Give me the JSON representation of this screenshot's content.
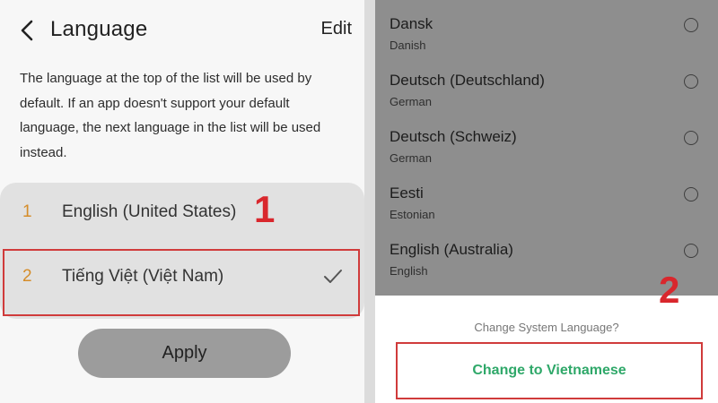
{
  "left": {
    "header": {
      "title": "Language",
      "edit_label": "Edit"
    },
    "description": "The language at the top of the list will be used by default. If an app doesn't support your default language, the next language in the list will be used instead.",
    "languages": [
      {
        "num": "1",
        "name": "English (United States)"
      },
      {
        "num": "2",
        "name": "Tiếng Việt (Việt Nam)",
        "selected": true
      }
    ],
    "step_label": "1",
    "apply_label": "Apply"
  },
  "right": {
    "items": [
      {
        "name": "Dansk",
        "sub": "Danish"
      },
      {
        "name": "Deutsch (Deutschland)",
        "sub": "German"
      },
      {
        "name": "Deutsch (Schweiz)",
        "sub": "German"
      },
      {
        "name": "Eesti",
        "sub": "Estonian"
      },
      {
        "name": "English (Australia)",
        "sub": "English"
      }
    ],
    "dialog_title": "Change System Language?",
    "change_label": "Change to Vietnamese",
    "step_label": "2"
  },
  "colors": {
    "accent_green": "#2fa869",
    "highlight_red": "#d03b3b",
    "number_orange": "#d58d2a",
    "step_red": "#d9272d"
  },
  "icons": {
    "back": "chevron-left-icon",
    "check": "check-icon",
    "radio": "radio-unchecked-icon"
  }
}
